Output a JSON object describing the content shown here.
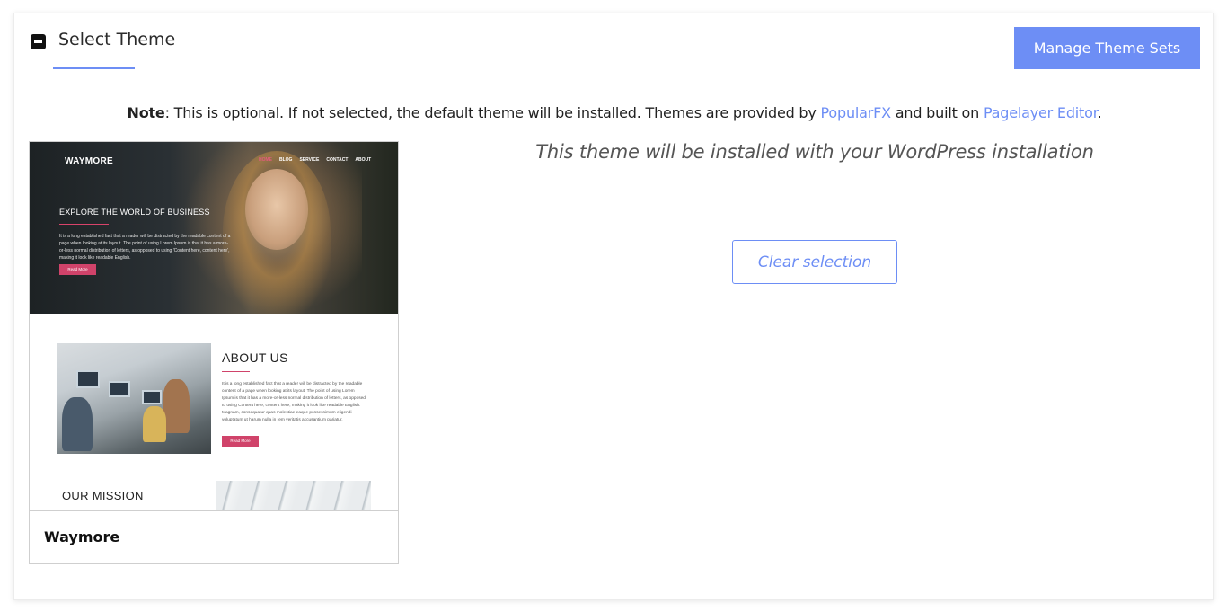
{
  "header": {
    "title": "Select Theme",
    "manage_button": "Manage Theme Sets"
  },
  "note": {
    "label": "Note",
    "text_before": ": This is optional. If not selected, the default theme will be installed. Themes are provided by ",
    "link1": "PopularFX",
    "text_middle": " and built on ",
    "link2": "Pagelayer Editor",
    "text_after": "."
  },
  "theme_card": {
    "name": "Waymore",
    "preview": {
      "logo": "WAYMORE",
      "nav": [
        "HOME",
        "BLOG",
        "SERVICE",
        "CONTACT",
        "ABOUT"
      ],
      "hero_heading": "EXPLORE THE WORLD OF BUSINESS",
      "hero_text": "It is a long established fact that a reader will be distracted by the readable content of a page when looking at its layout. The point of using Lorem Ipsum is that it has a more-or-less normal distribution of letters, as opposed to using 'Content here, content here', making it look like readable English.",
      "hero_button": "Read More",
      "about_title": "ABOUT US",
      "about_text": "It is a long established fact that a reader will be distracted by the readable content of a page when looking at its layout. The point of using Lorem Ipsum is that it has a more-or-less normal distribution of letters, as opposed to using Content here, content here, making it look like readable English. Magnam, consequatur quas molestiae eaque possessimum eligendi voluptatum ut harum nulla in rem veritatis accusantium pariatur.",
      "about_button": "Read More",
      "mission_title": "OUR MISSION"
    }
  },
  "install_note": "This theme will be installed with your WordPress installation",
  "clear_button": "Clear selection",
  "colors": {
    "accent": "#6d8ef5",
    "preview_accent": "#d0436a"
  }
}
